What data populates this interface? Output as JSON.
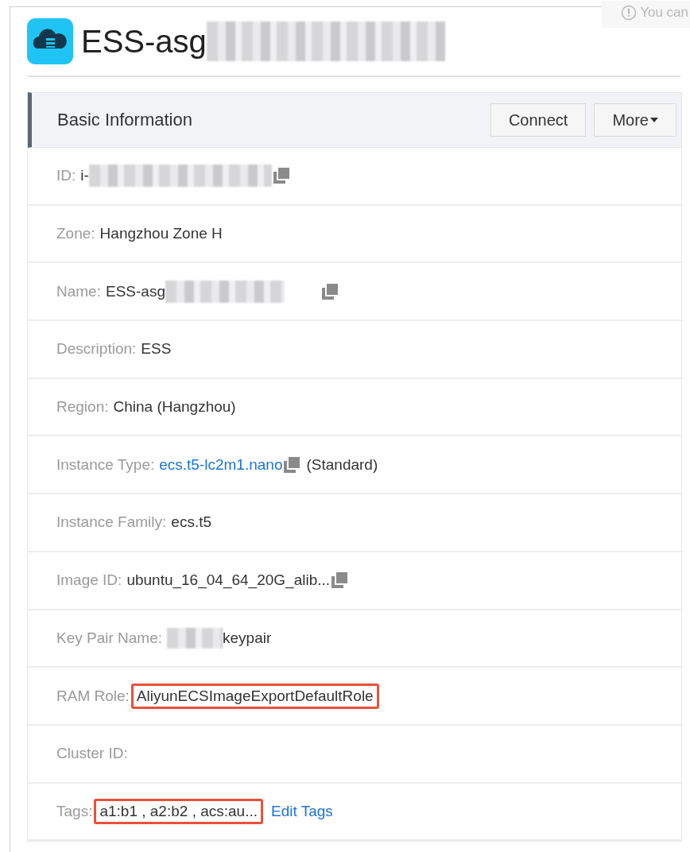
{
  "notice": {
    "text": "You can"
  },
  "header": {
    "title": "ESS-asg",
    "title_redacted": true
  },
  "panel": {
    "title": "Basic Information",
    "buttons": [
      {
        "label": "Connect",
        "caret": false
      },
      {
        "label": "More",
        "caret": true
      }
    ],
    "rows": [
      {
        "label": "ID:",
        "value": "i-",
        "redacted_after": true,
        "copy": true
      },
      {
        "label": "Zone:",
        "value": "Hangzhou Zone H"
      },
      {
        "label": "Name:",
        "value": "ESS-asg",
        "redacted_after": true,
        "copy": true
      },
      {
        "label": "Description:",
        "value": "ESS"
      },
      {
        "label": "Region:",
        "value": "China (Hangzhou)"
      },
      {
        "label": "Instance Type:",
        "value": "ecs.t5-lc2m1.nano",
        "link": true,
        "copy": true,
        "suffix": "(Standard)"
      },
      {
        "label": "Instance Family:",
        "value": "ecs.t5"
      },
      {
        "label": "Image ID:",
        "value": "ubuntu_16_04_64_20G_alib...",
        "copy": true
      },
      {
        "label": "Key Pair Name:",
        "value": "keypair",
        "redacted_before": true
      },
      {
        "label": "RAM Role:",
        "value": "AliyunECSImageExportDefaultRole",
        "highlighted": true
      },
      {
        "label": "Cluster ID:"
      },
      {
        "label": "Tags:",
        "value": "a1:b1 , a2:b2 , acs:au...",
        "highlighted": true,
        "action": "Edit Tags"
      }
    ]
  }
}
